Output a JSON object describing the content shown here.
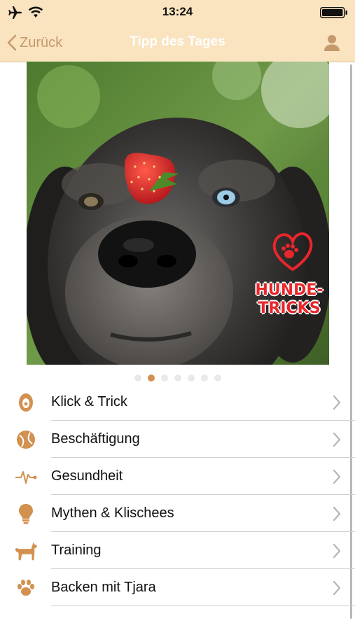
{
  "status_bar": {
    "time": "13:24"
  },
  "nav": {
    "back_label": "Zurück",
    "title": "Tipp des Tages"
  },
  "photo": {
    "subject": "dog-with-strawberry",
    "logo_text_line1": "HUNDE-",
    "logo_text_line2": "TRICKS"
  },
  "pager": {
    "count": 7,
    "active_index": 1
  },
  "menu": [
    {
      "label": "Klick & Trick",
      "icon": "clicker-icon"
    },
    {
      "label": "Beschäftigung",
      "icon": "ball-icon"
    },
    {
      "label": "Gesundheit",
      "icon": "heartbeat-icon"
    },
    {
      "label": "Mythen & Klischees",
      "icon": "lightbulb-icon"
    },
    {
      "label": "Training",
      "icon": "dog-icon"
    },
    {
      "label": "Backen mit Tjara",
      "icon": "paw-icon"
    }
  ],
  "colors": {
    "nav_bg": "#fae3bf",
    "accent": "#d2914f",
    "back_text": "#c49a6c",
    "active_dot": "#d2914f"
  }
}
